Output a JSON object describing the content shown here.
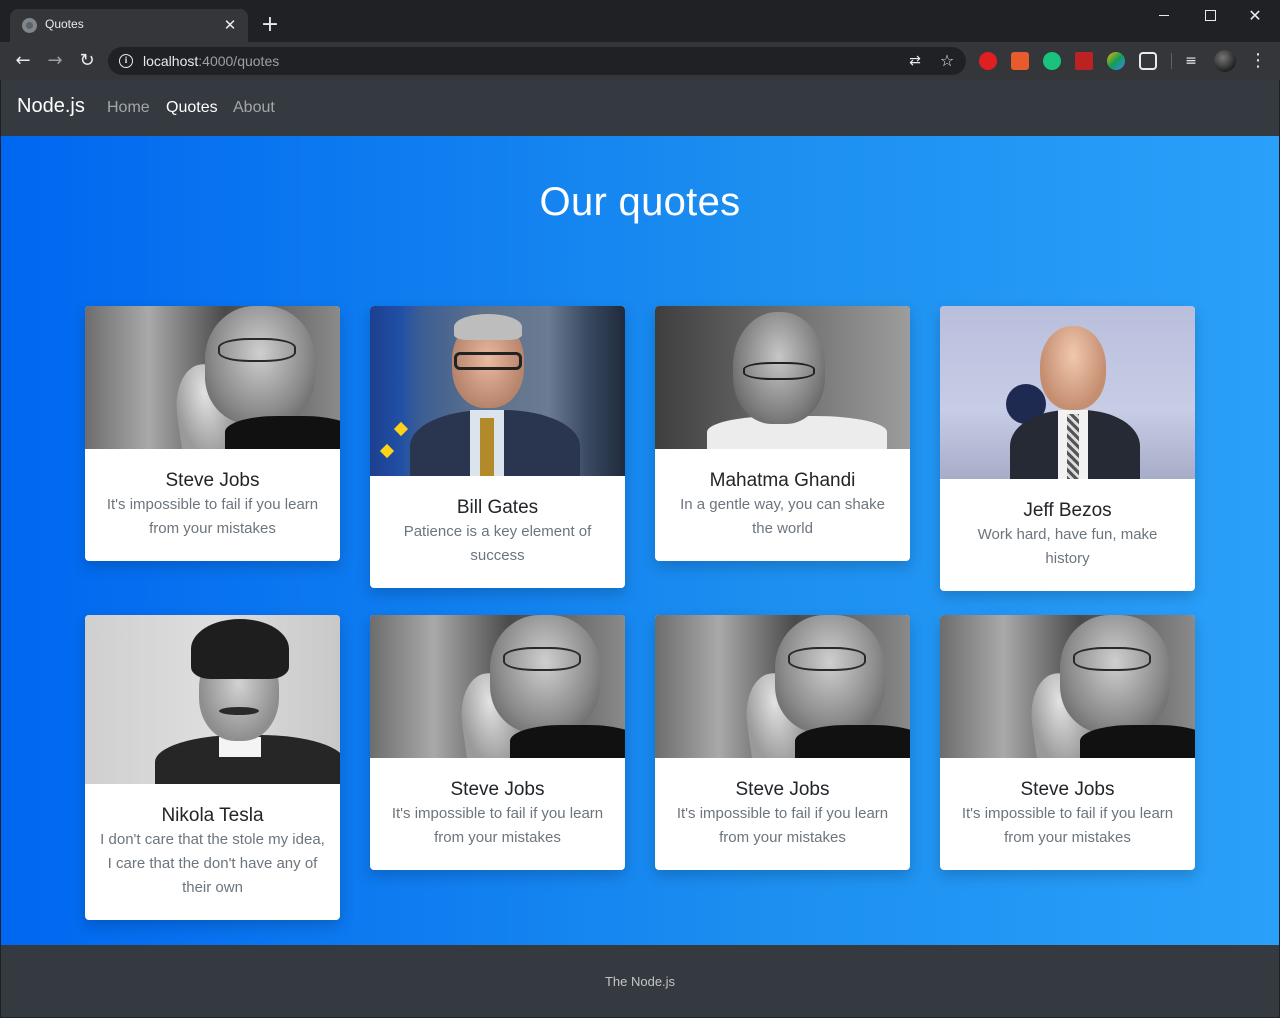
{
  "browser": {
    "tab_title": "Quotes",
    "url_host": "localhost",
    "url_path": ":4000/quotes"
  },
  "navbar": {
    "brand": "Node.js",
    "links": [
      {
        "label": "Home",
        "active": false
      },
      {
        "label": "Quotes",
        "active": true
      },
      {
        "label": "About",
        "active": false
      }
    ]
  },
  "hero": {
    "title": "Our quotes"
  },
  "quotes": [
    {
      "name": "Steve Jobs",
      "quote": "It's impossible to fail if you learn from your mistakes",
      "portrait": "steve-jobs-portrait"
    },
    {
      "name": "Bill Gates",
      "quote": "Patience is a key element of success",
      "portrait": "bill-gates-portrait"
    },
    {
      "name": "Mahatma Ghandi",
      "quote": "In a gentle way, you can shake the world",
      "portrait": "mahatma-ghandi-portrait"
    },
    {
      "name": "Jeff Bezos",
      "quote": "Work hard, have fun, make history",
      "portrait": "jeff-bezos-portrait"
    },
    {
      "name": "Nikola Tesla",
      "quote": "I don't care that the stole my idea, I care that the don't have any of their own",
      "portrait": "nikola-tesla-portrait"
    },
    {
      "name": "Steve Jobs",
      "quote": "It's impossible to fail if you learn from your mistakes",
      "portrait": "steve-jobs-portrait"
    },
    {
      "name": "Steve Jobs",
      "quote": "It's impossible to fail if you learn from your mistakes",
      "portrait": "steve-jobs-portrait"
    },
    {
      "name": "Steve Jobs",
      "quote": "It's impossible to fail if you learn from your mistakes",
      "portrait": "steve-jobs-portrait"
    }
  ],
  "footer": {
    "text": "The Node.js"
  },
  "colors": {
    "navbar_bg": "#343a40",
    "hero_gradient_start": "#0067f0",
    "hero_gradient_end": "#2aa0fa",
    "card_bg": "#ffffff",
    "quote_text": "#6c757d"
  }
}
